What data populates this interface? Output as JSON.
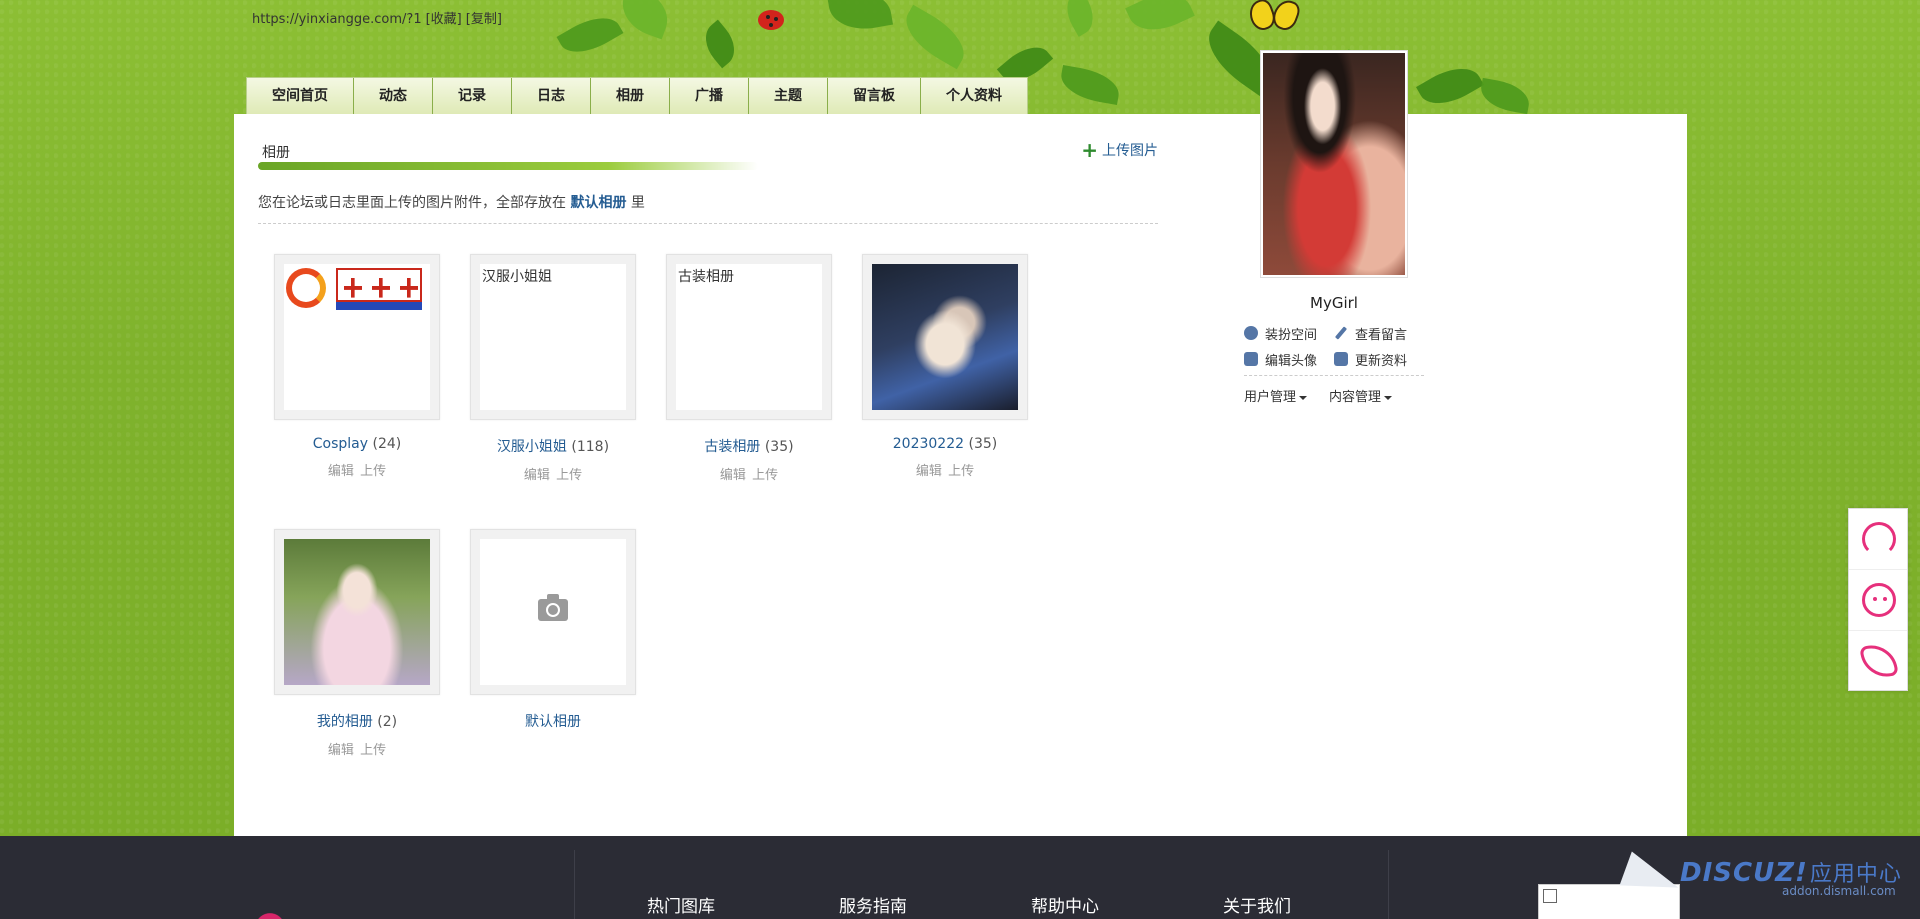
{
  "header": {
    "url_line": [
      "https://yinxiangge.com/?1",
      "[收藏]",
      "[复制]"
    ]
  },
  "nav": {
    "tabs": [
      "空间首页",
      "动态",
      "记录",
      "日志",
      "相册",
      "广播",
      "主题",
      "留言板",
      "个人资料"
    ]
  },
  "section": {
    "title": "相册",
    "upload_label": "上传图片",
    "intro_before": "您在论坛或日志里面上传的图片附件，全部存放在",
    "intro_link": "默认相册",
    "intro_after": "里"
  },
  "albums": [
    {
      "name": "Cosplay",
      "count": "(24)",
      "alt": "",
      "op_edit": "编辑",
      "op_upload": "上传"
    },
    {
      "name": "汉服小姐姐",
      "count": "(118)",
      "alt": "汉服小姐姐",
      "op_edit": "编辑",
      "op_upload": "上传"
    },
    {
      "name": "古装相册",
      "count": "(35)",
      "alt": "古装相册",
      "op_edit": "编辑",
      "op_upload": "上传"
    },
    {
      "name": "20230222",
      "count": "(35)",
      "alt": "",
      "op_edit": "编辑",
      "op_upload": "上传"
    },
    {
      "name": "我的相册",
      "count": "(2)",
      "alt": "",
      "op_edit": "编辑",
      "op_upload": "上传"
    },
    {
      "name": "默认相册",
      "count": "",
      "alt": ""
    }
  ],
  "profile": {
    "username": "MyGirl",
    "links": [
      "装扮空间",
      "查看留言",
      "编辑头像",
      "更新资料"
    ],
    "menus": [
      "用户管理",
      "内容管理"
    ]
  },
  "footer": {
    "columns": [
      "热门图库",
      "服务指南",
      "帮助中心",
      "关于我们"
    ],
    "brand": "DISCUZ!",
    "brand_cn": "应用中心",
    "brand_url": "addon.dismall.com"
  },
  "icons": {
    "upload": "plus-icon",
    "default_album": "camera-icon",
    "side": [
      "headset-icon",
      "chat-bubble-icon",
      "phone-icon"
    ]
  },
  "colors": {
    "link": "#245c92",
    "accent": "#e6307c",
    "footer_bg": "#2b2c35"
  }
}
